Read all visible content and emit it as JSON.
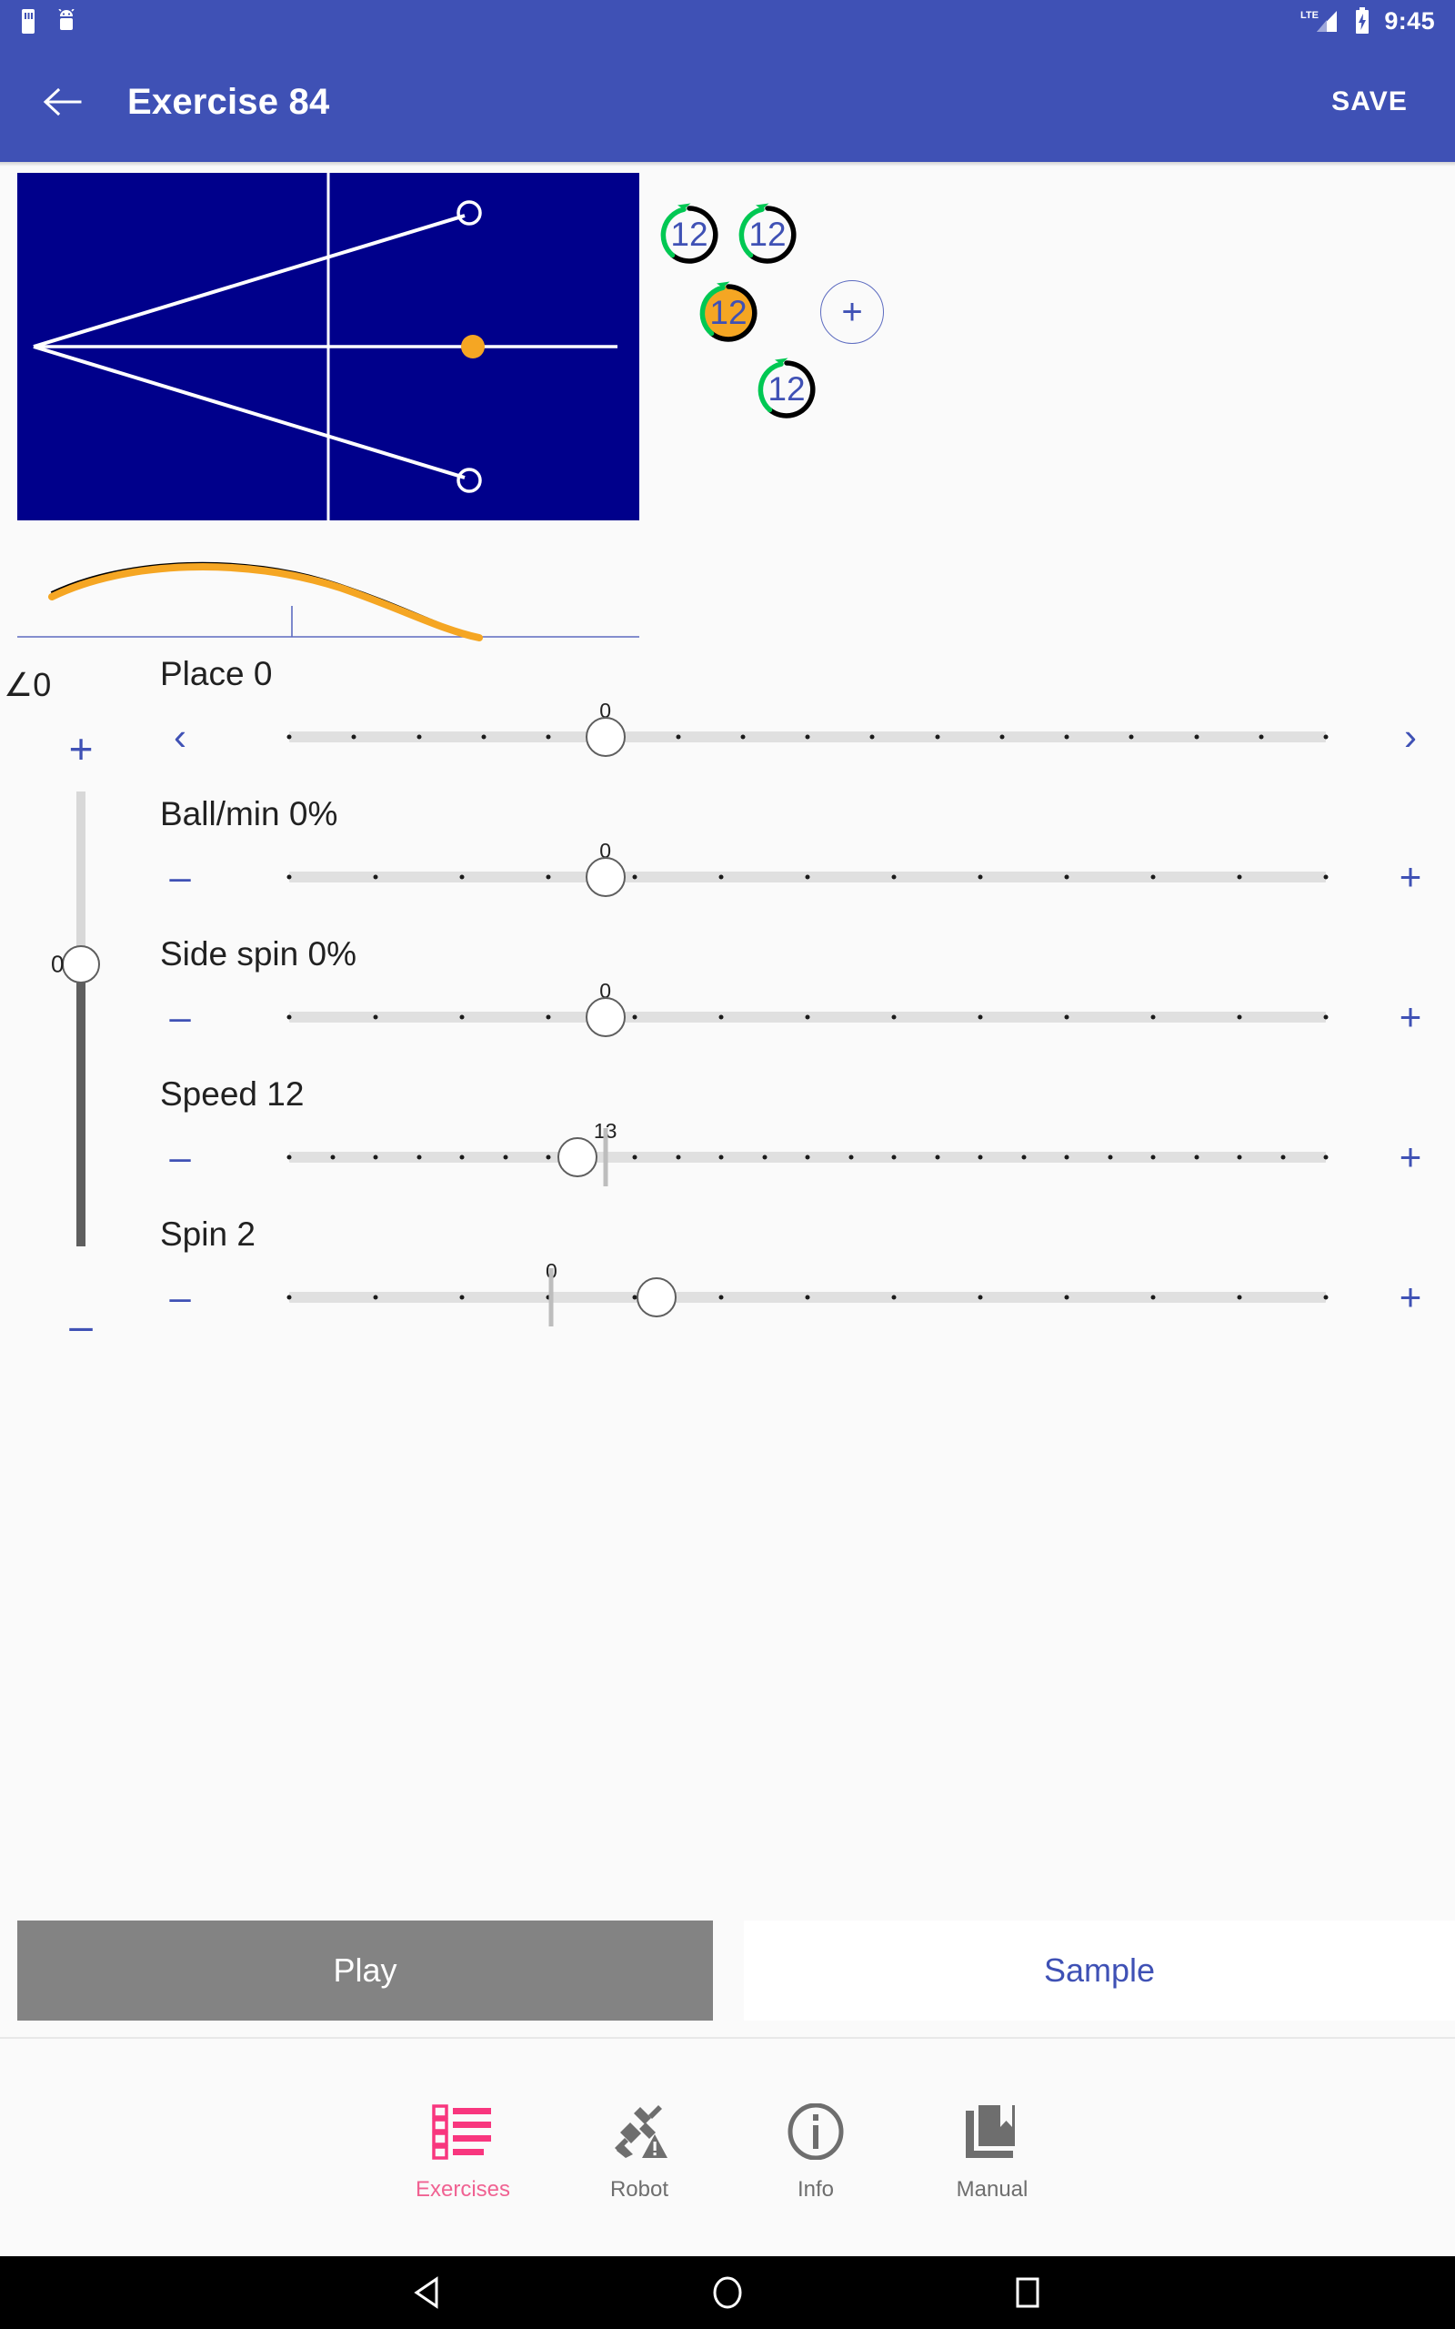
{
  "status_bar": {
    "time": "9:45",
    "network_label": "LTE",
    "icons": [
      "sd-card-icon",
      "android-robot-icon",
      "lte-signal-icon",
      "battery-charging-icon"
    ]
  },
  "app_bar": {
    "back_icon": "back-arrow-icon",
    "title": "Exercise 84",
    "save_label": "SAVE",
    "bg_color": "#3F51B5"
  },
  "table_diagram": {
    "name": "ping-pong-table-placement-diagram",
    "bg_color": "#00008B",
    "line_color": "#FFFFFF",
    "ball_color": "#F5A623",
    "targets": [
      {
        "label": "upper-target",
        "filled": false
      },
      {
        "label": "center-target",
        "filled": true
      },
      {
        "label": "lower-target",
        "filled": false
      }
    ]
  },
  "spin_badges": {
    "add_label": "+",
    "items": [
      {
        "value": "12",
        "selected": false,
        "name": "spin-badge-1"
      },
      {
        "value": "12",
        "selected": false,
        "name": "spin-badge-2"
      },
      {
        "value": "12",
        "selected": true,
        "name": "spin-badge-3"
      },
      {
        "value": "12",
        "selected": false,
        "name": "spin-badge-4"
      }
    ],
    "selected_color": "#F5A623",
    "arc_color": "#00C853",
    "text_color": "#3F51B5"
  },
  "trajectory": {
    "name": "ball-trajectory-preview",
    "curve_color": "#F5A623",
    "shadow_color": "#000000"
  },
  "angle_indicator": {
    "label": "∠0"
  },
  "vertical_slider": {
    "name": "angle-slider",
    "plus_label": "+",
    "minus_label": "–",
    "value": "0",
    "percent": 38
  },
  "sliders": [
    {
      "name": "place-slider",
      "label": "Place 0",
      "value_label": "0",
      "left_btn": "‹",
      "right_btn": "›",
      "thumb_percent": 30.5,
      "value_percent": 30.5,
      "ticks": 17,
      "marker_percent": null
    },
    {
      "name": "ball-per-min-slider",
      "label": "Ball/min 0%",
      "value_label": "0",
      "left_btn": "–",
      "right_btn": "+",
      "thumb_percent": 30.5,
      "value_percent": 30.5,
      "ticks": 13,
      "marker_percent": null
    },
    {
      "name": "side-spin-slider",
      "label": "Side spin 0%",
      "value_label": "0",
      "left_btn": "–",
      "right_btn": "+",
      "thumb_percent": 30.5,
      "value_percent": 30.5,
      "ticks": 13,
      "marker_percent": null
    },
    {
      "name": "speed-slider",
      "label": "Speed 12",
      "value_label": "13",
      "left_btn": "–",
      "right_btn": "+",
      "thumb_percent": 27.8,
      "value_percent": 30.5,
      "ticks": 25,
      "marker_percent": 30.5
    },
    {
      "name": "spin-slider",
      "label": "Spin 2",
      "value_label": "0",
      "left_btn": "–",
      "right_btn": "+",
      "thumb_percent": 35.4,
      "value_percent": 25.3,
      "ticks": 13,
      "marker_percent": 25.3
    }
  ],
  "actions": {
    "play_label": "Play",
    "sample_label": "Sample",
    "play_bg": "#838383",
    "sample_color": "#3F51B5"
  },
  "bottom_nav": {
    "items": [
      {
        "label": "Exercises",
        "icon": "list-icon",
        "active": true
      },
      {
        "label": "Robot",
        "icon": "robot-disconnected-icon",
        "active": false
      },
      {
        "label": "Info",
        "icon": "info-circle-icon",
        "active": false
      },
      {
        "label": "Manual",
        "icon": "book-bookmark-icon",
        "active": false
      }
    ],
    "active_color": "#F06292",
    "inactive_color": "#6E6E6E"
  },
  "android_nav": {
    "back": "triangle-back-icon",
    "home": "circle-home-icon",
    "recents": "square-recents-icon"
  }
}
